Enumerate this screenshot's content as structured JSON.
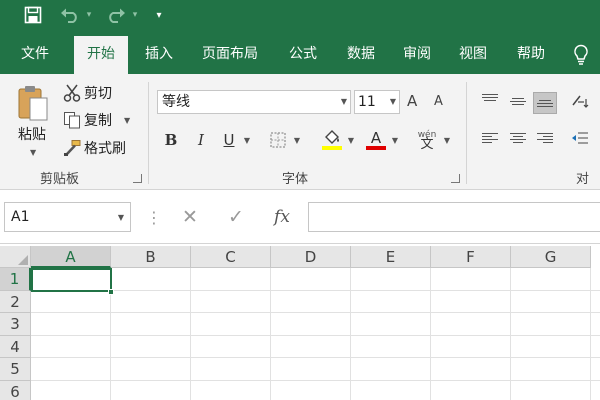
{
  "colors": {
    "brand": "#217346",
    "fill_swatch": "#ffff00",
    "font_swatch": "#e00000"
  },
  "titlebar": {
    "qat_more": "▾"
  },
  "tabs": {
    "file": "文件",
    "home": "开始",
    "insert": "插入",
    "page_layout": "页面布局",
    "formulas": "公式",
    "data": "数据",
    "review": "审阅",
    "view": "视图",
    "help": "帮助"
  },
  "clipboard": {
    "paste": "粘贴",
    "cut": "剪切",
    "copy": "复制",
    "format_painter": "格式刷",
    "group_label": "剪贴板"
  },
  "font": {
    "name": "等线",
    "size": "11",
    "grow": "A",
    "shrink": "A",
    "bold": "B",
    "italic": "I",
    "underline": "U",
    "phonetic_top": "wén",
    "phonetic_bottom": "文",
    "group_label": "字体"
  },
  "alignment": {
    "group_label": "对齐"
  },
  "formula_bar": {
    "name_box": "A1",
    "separator": "⋮",
    "cancel": "✕",
    "enter": "✓",
    "fx": "fx"
  },
  "grid": {
    "columns": [
      "A",
      "B",
      "C",
      "D",
      "E",
      "F",
      "G"
    ],
    "rows": [
      "1",
      "2",
      "3",
      "4",
      "5",
      "6"
    ],
    "active_cell": "A1"
  }
}
